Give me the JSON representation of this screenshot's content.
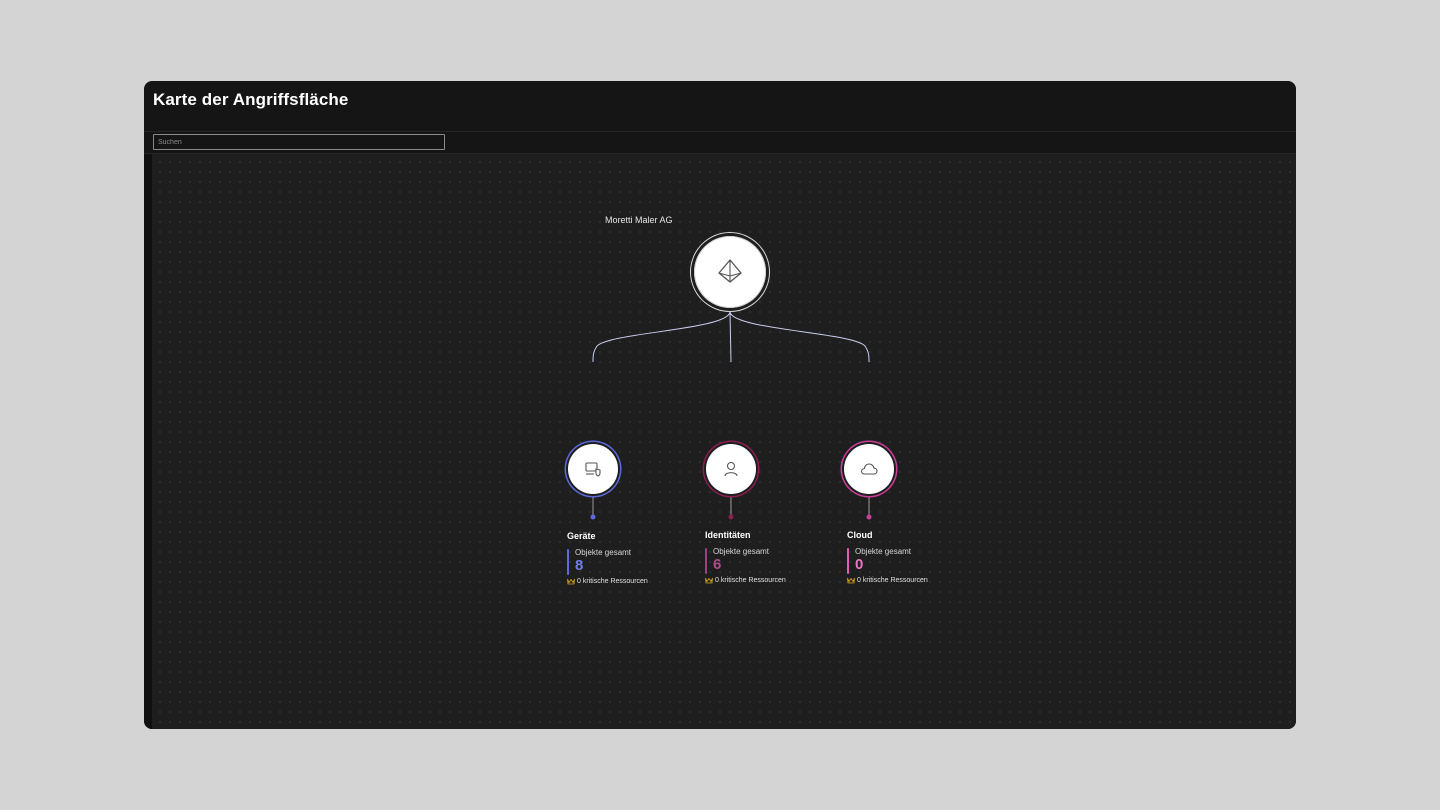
{
  "window": {
    "title": "Karte der Angriffsfläche"
  },
  "search": {
    "placeholder": "Suchen",
    "value": ""
  },
  "map": {
    "organization": "Moretti Maler AG",
    "root_icon": "pyramid-icon",
    "categories": [
      {
        "id": "devices",
        "title": "Geräte",
        "icon": "device-shield-icon",
        "accent": "#5c6bdc",
        "ring": "#5c6bdc",
        "stat_label": "Objekte gesamt",
        "total": "8",
        "critical": "0 kritische Ressourcen"
      },
      {
        "id": "identities",
        "title": "Identitäten",
        "icon": "person-icon",
        "accent": "#a43f86",
        "ring": "#8a1f52",
        "stat_label": "Objekte gesamt",
        "total": "6",
        "critical": "0 kritische Ressourcen"
      },
      {
        "id": "cloud",
        "title": "Cloud",
        "icon": "cloud-icon",
        "accent": "#e05fb5",
        "ring": "#cc3d9c",
        "stat_label": "Objekte gesamt",
        "total": "0",
        "critical": "0 kritische Ressourcen"
      }
    ]
  },
  "colors": {
    "background": "#151515",
    "canvas": "#1e1e1e",
    "critical_icon": "#d4a21a",
    "connector": "#c9ccee"
  }
}
